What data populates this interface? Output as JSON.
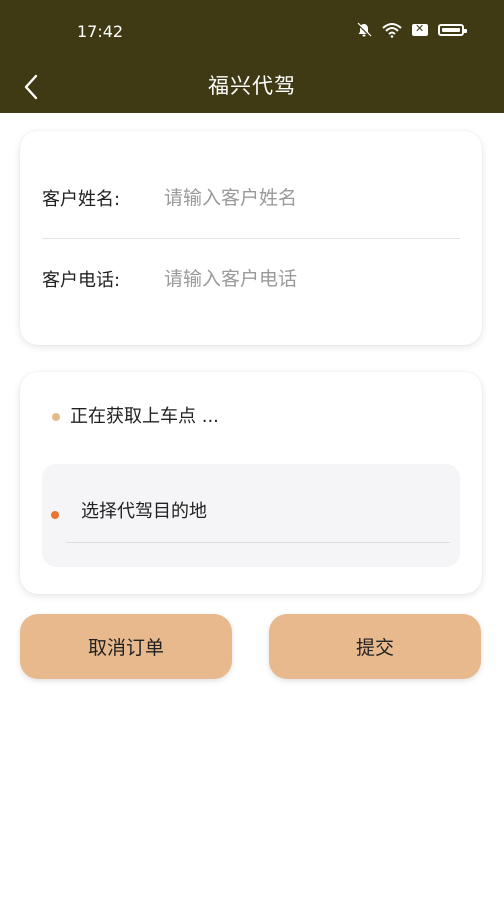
{
  "status_bar": {
    "time": "17:42",
    "icons": [
      "bell-off-icon",
      "wifi-icon",
      "close-box-icon",
      "battery-icon"
    ]
  },
  "nav": {
    "back_icon": "chevron-left-icon",
    "title": "福兴代驾"
  },
  "customer_form": {
    "name_label": "客户姓名:",
    "name_placeholder": "请输入客户姓名",
    "name_value": "",
    "phone_label": "客户电话:",
    "phone_placeholder": "请输入客户电话",
    "phone_value": ""
  },
  "route": {
    "pickup_text": "正在获取上车点 ...",
    "destination_text": "选择代驾目的地"
  },
  "actions": {
    "cancel_label": "取消订单",
    "submit_label": "提交"
  },
  "colors": {
    "header_bg": "#3f3a14",
    "button_bg": "#e7b98d",
    "pickup_dot": "#e3b98c",
    "destination_dot": "#e8742e"
  }
}
